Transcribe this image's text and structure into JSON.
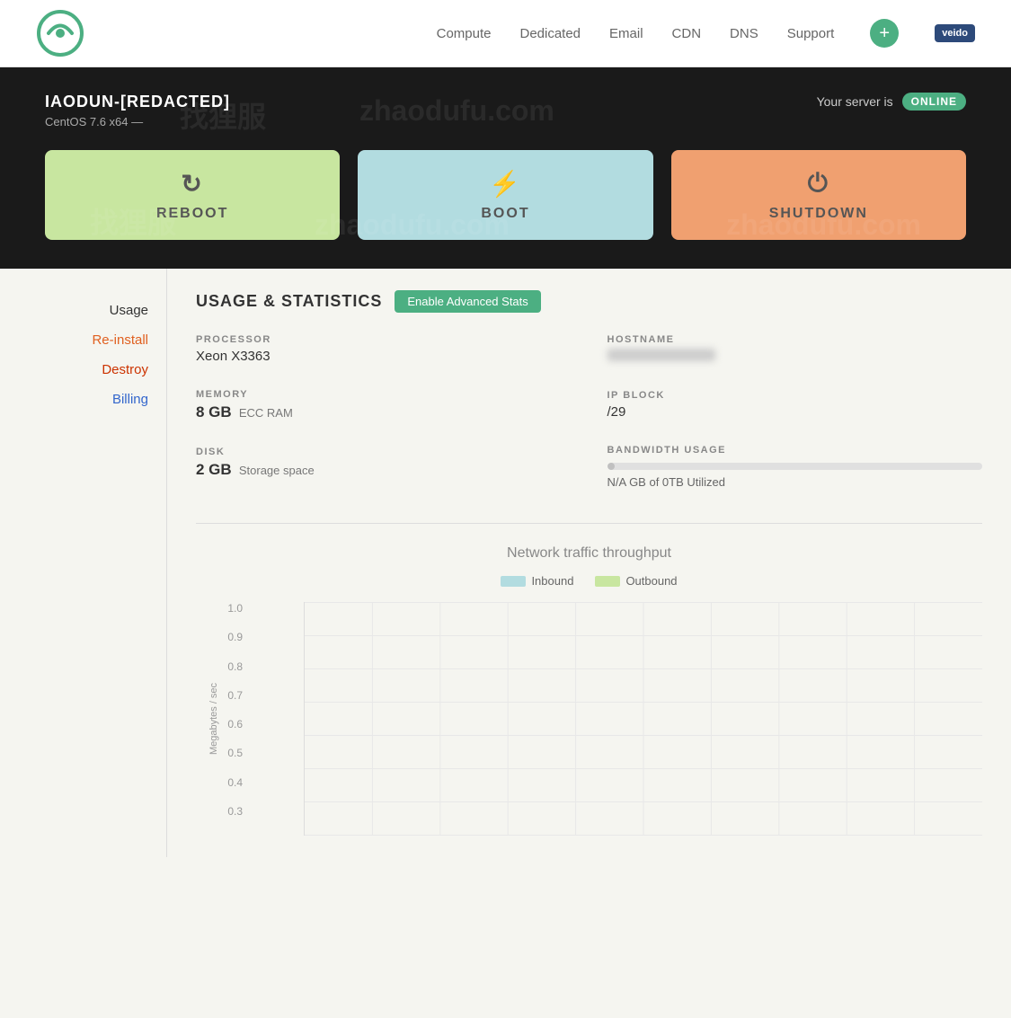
{
  "header": {
    "logo_alt": "Logo",
    "nav": {
      "compute": "Compute",
      "dedicated": "Dedicated",
      "email": "Email",
      "cdn": "CDN",
      "dns": "DNS",
      "support": "Support",
      "add_icon": "+",
      "user_badge": "veido"
    }
  },
  "hero": {
    "server_id": "IAODUN-[REDACTED]",
    "server_os": "CentOS 7.6 x64 —",
    "status_label": "Your server is",
    "status_value": "ONLINE",
    "reboot_label": "REBOOT",
    "boot_label": "BOOT",
    "shutdown_label": "SHUTDOWN"
  },
  "sidebar": {
    "items": [
      {
        "label": "Usage",
        "style": "active"
      },
      {
        "label": "Re-install",
        "style": "orange"
      },
      {
        "label": "Destroy",
        "style": "red"
      },
      {
        "label": "Billing",
        "style": "blue"
      }
    ]
  },
  "usage_stats": {
    "section_title": "USAGE & STATISTICS",
    "enable_btn": "Enable Advanced Stats",
    "processor_label": "PROCESSOR",
    "processor_value": "Xeon X3363",
    "memory_label": "MEMORY",
    "memory_value": "8 GB",
    "memory_unit": "ECC RAM",
    "disk_label": "DISK",
    "disk_value": "2 GB",
    "disk_unit": "Storage space",
    "hostname_label": "HOSTNAME",
    "hostname_value": "",
    "ip_block_label": "IP BLOCK",
    "ip_block_value": "/29",
    "bandwidth_label": "BANDWIDTH USAGE",
    "bandwidth_used": "N/A GB of 0TB Utilized",
    "bandwidth_percent": 2
  },
  "chart": {
    "title": "Network traffic throughput",
    "inbound_label": "Inbound",
    "outbound_label": "Outbound",
    "y_axis_label": "Megabytes / sec",
    "y_values": [
      "1.0",
      "0.9",
      "0.8",
      "0.7",
      "0.6",
      "0.5",
      "0.4",
      "0.3"
    ],
    "x_labels": [
      "",
      "",
      "",
      "",
      "",
      "",
      "",
      "",
      "",
      "",
      "",
      ""
    ]
  }
}
